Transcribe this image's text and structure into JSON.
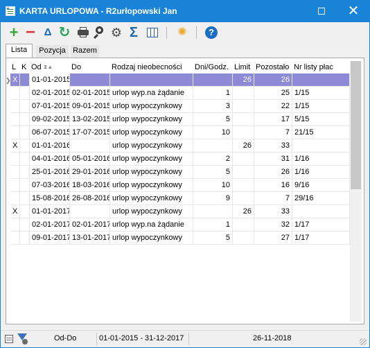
{
  "window": {
    "title": "KARTA URLOPOWA - R2urłopowski Jan"
  },
  "colors": {
    "titlebar": "#1883d7",
    "selection": "#8f8ad6"
  },
  "toolbar": {
    "icons": [
      "plus-icon",
      "minus-icon",
      "triangle-icon",
      "refresh-icon",
      "print-icon",
      "search-icon",
      "gear-icon",
      "sigma-icon",
      "columns-icon",
      "sun-icon",
      "help-icon"
    ],
    "glyphs": {
      "plus": "+",
      "minus": "−",
      "delta": "Δ",
      "refresh": "↻",
      "gear": "⚙",
      "sigma": "Σ",
      "sun": "✺",
      "help": "?"
    }
  },
  "tabs": [
    {
      "label": "Lista",
      "active": true
    },
    {
      "label": "Pozycja",
      "active": false
    },
    {
      "label": "Razem",
      "active": false
    }
  ],
  "grid": {
    "headers": [
      "L",
      "K",
      "Od",
      "Do",
      "Rodzaj nieobecności",
      "Dni/Godz.",
      "Limit",
      "Pozostało",
      "Nr listy płac"
    ],
    "rows": [
      {
        "l": "X",
        "k": "",
        "od": "01-01-2015",
        "do": "",
        "rodzaj": "",
        "dni": "",
        "limit": "26",
        "pozostalo": "26",
        "nr": "",
        "selected": true
      },
      {
        "l": "",
        "k": "",
        "od": "02-01-2015",
        "do": "02-01-2015",
        "rodzaj": "urlop wyp.na żądanie",
        "dni": "1",
        "limit": "",
        "pozostalo": "25",
        "nr": "1/15"
      },
      {
        "l": "",
        "k": "",
        "od": "07-01-2015",
        "do": "09-01-2015",
        "rodzaj": "urlop wypoczynkowy",
        "dni": "3",
        "limit": "",
        "pozostalo": "22",
        "nr": "1/15"
      },
      {
        "l": "",
        "k": "",
        "od": "09-02-2015",
        "do": "13-02-2015",
        "rodzaj": "urlop wypoczynkowy",
        "dni": "5",
        "limit": "",
        "pozostalo": "17",
        "nr": "5/15"
      },
      {
        "l": "",
        "k": "",
        "od": "06-07-2015",
        "do": "17-07-2015",
        "rodzaj": "urlop wypoczynkowy",
        "dni": "10",
        "limit": "",
        "pozostalo": "7",
        "nr": "21/15"
      },
      {
        "l": "X",
        "k": "",
        "od": "01-01-2016",
        "do": "",
        "rodzaj": "urlop wypoczynkowy",
        "dni": "",
        "limit": "26",
        "pozostalo": "33",
        "nr": ""
      },
      {
        "l": "",
        "k": "",
        "od": "04-01-2016",
        "do": "05-01-2016",
        "rodzaj": "urlop wypoczynkowy",
        "dni": "2",
        "limit": "",
        "pozostalo": "31",
        "nr": "1/16"
      },
      {
        "l": "",
        "k": "",
        "od": "25-01-2016",
        "do": "29-01-2016",
        "rodzaj": "urlop wypoczynkowy",
        "dni": "5",
        "limit": "",
        "pozostalo": "26",
        "nr": "1/16"
      },
      {
        "l": "",
        "k": "",
        "od": "07-03-2016",
        "do": "18-03-2016",
        "rodzaj": "urlop wypoczynkowy",
        "dni": "10",
        "limit": "",
        "pozostalo": "16",
        "nr": "9/16"
      },
      {
        "l": "",
        "k": "",
        "od": "15-08-2016",
        "do": "26-08-2016",
        "rodzaj": "urlop wypoczynkowy",
        "dni": "9",
        "limit": "",
        "pozostalo": "7",
        "nr": "29/16"
      },
      {
        "l": "X",
        "k": "",
        "od": "01-01-2017",
        "do": "",
        "rodzaj": "urlop wypoczynkowy",
        "dni": "",
        "limit": "26",
        "pozostalo": "33",
        "nr": ""
      },
      {
        "l": "",
        "k": "",
        "od": "02-01-2017",
        "do": "02-01-2017",
        "rodzaj": "urlop wyp.na żądanie",
        "dni": "1",
        "limit": "",
        "pozostalo": "32",
        "nr": "1/17"
      },
      {
        "l": "",
        "k": "",
        "od": "09-01-2017",
        "do": "13-01-2017",
        "rodzaj": "urlop wypoczynkowy",
        "dni": "5",
        "limit": "",
        "pozostalo": "27",
        "nr": "1/17"
      }
    ]
  },
  "status": {
    "label": "Od-Do",
    "range": "01-01-2015 - 31-12-2017",
    "date": "26-11-2018"
  }
}
